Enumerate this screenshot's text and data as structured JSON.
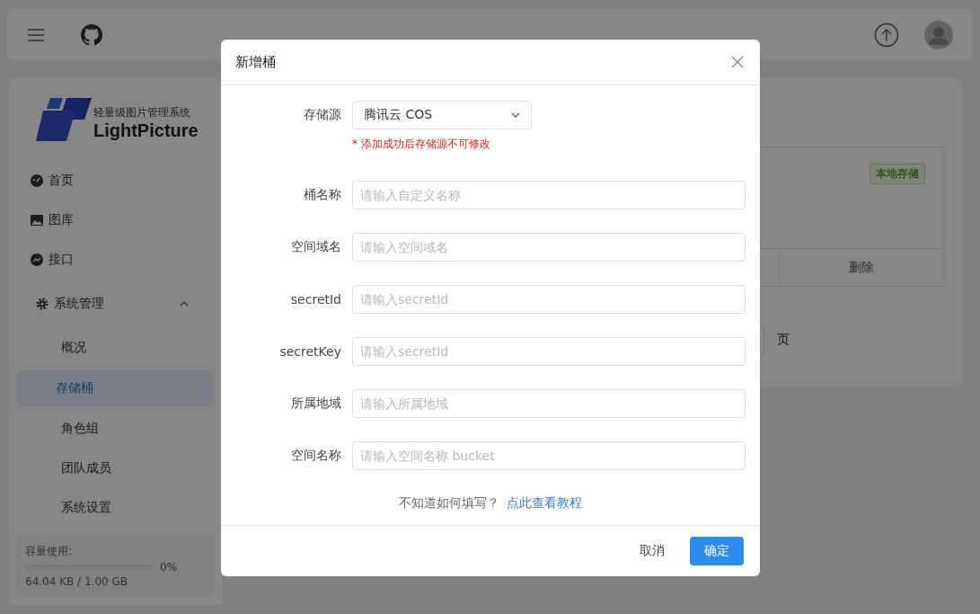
{
  "sidebar": {
    "logo": {
      "subtitle": "轻量级图片管理系统",
      "name": "LightPicture"
    },
    "items": [
      {
        "label": "首页",
        "kind": "dashboard",
        "selected": false
      },
      {
        "label": "图库",
        "kind": "image",
        "selected": false
      },
      {
        "label": "接口",
        "kind": "chart",
        "selected": false
      }
    ],
    "group": {
      "label": "系统管理",
      "expanded": true,
      "children": [
        {
          "label": "概况",
          "selected": false
        },
        {
          "label": "存储桶",
          "selected": true
        },
        {
          "label": "角色组",
          "selected": false
        },
        {
          "label": "团队成员",
          "selected": false
        },
        {
          "label": "系统设置",
          "selected": false
        }
      ]
    },
    "usage": {
      "label": "容量使用:",
      "level": 0,
      "percent": "0%",
      "amount": "64.04 KB / 1.00 GB"
    }
  },
  "storage_card": {
    "tag": "本地存储",
    "action": "删除"
  },
  "pagination": {
    "suffix": "页"
  },
  "dialog": {
    "title": "新增桶",
    "source": {
      "label": "存储源",
      "value": "腾讯云 COS",
      "note": "* 添加成功后存储源不可修改"
    },
    "fields": [
      {
        "label": "桶名称",
        "placeholder": "请输入自定义名称"
      },
      {
        "label": "空间域名",
        "placeholder": "请输入空间域名"
      },
      {
        "label": "secretId",
        "placeholder": "请输入secretId"
      },
      {
        "label": "secretKey",
        "placeholder": "请输入secretId"
      },
      {
        "label": "所属地域",
        "placeholder": "请输入所属地域"
      },
      {
        "label": "空间名称",
        "placeholder": "请输入空间名称 bucket"
      }
    ],
    "help": {
      "text": "不知道如何填写？",
      "link": "点此查看教程"
    },
    "buttons": [
      {
        "label": "取消",
        "kind": "text"
      },
      {
        "label": "确定",
        "kind": "primary"
      }
    ]
  }
}
